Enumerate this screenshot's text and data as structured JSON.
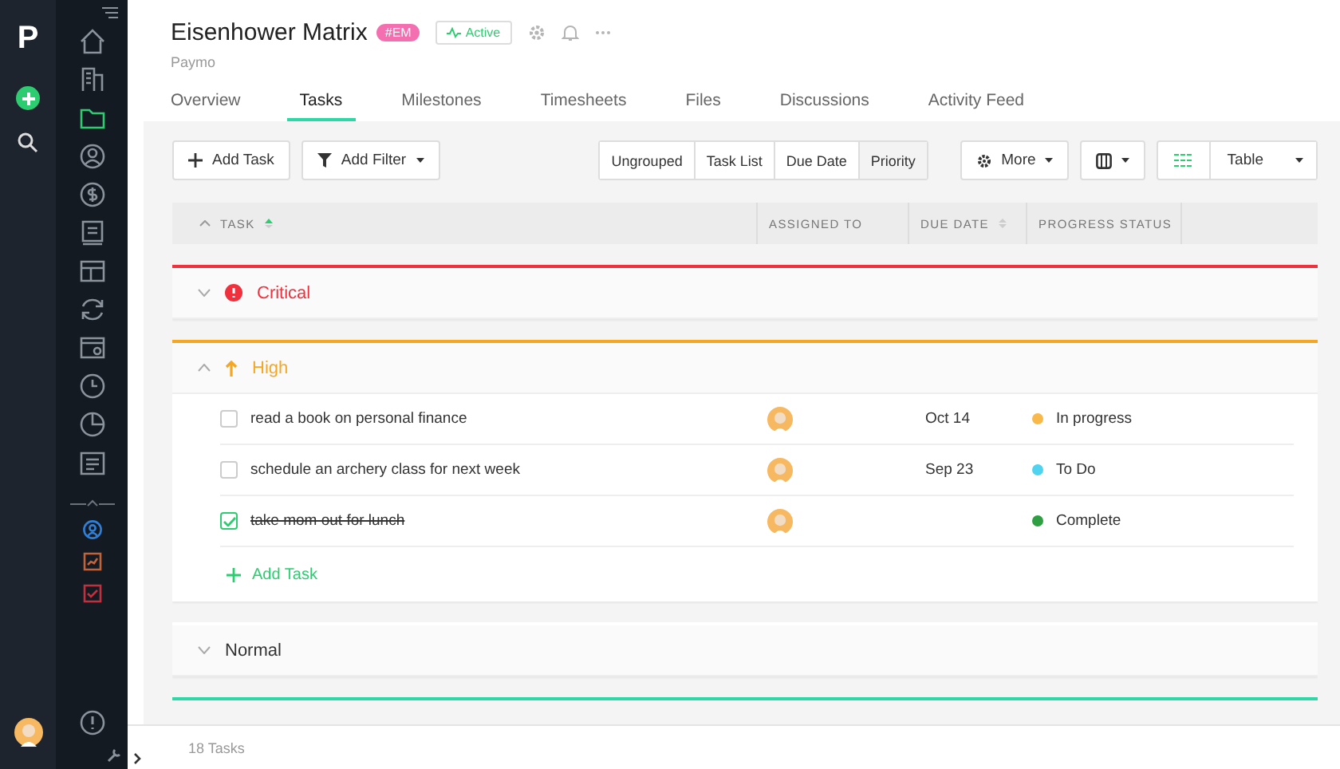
{
  "rail": {
    "logo": "P",
    "items": [
      {
        "selected": false
      },
      {
        "selected": false
      },
      {
        "selected": true
      },
      {
        "selected": false
      },
      {
        "selected": false
      },
      {
        "selected": false
      },
      {
        "selected": false
      },
      {
        "selected": false
      },
      {
        "selected": false
      },
      {
        "selected": false
      },
      {
        "selected": false
      },
      {
        "selected": false
      }
    ],
    "shortcuts": [
      {
        "color": "#2f7fd6"
      },
      {
        "color": "#c0623a"
      },
      {
        "color": "#c0303e"
      }
    ]
  },
  "header": {
    "title": "Eisenhower Matrix",
    "tag": "#EM",
    "status": "Active",
    "client": "Paymo"
  },
  "tabs": [
    {
      "label": "Overview",
      "selected": false
    },
    {
      "label": "Tasks",
      "selected": true
    },
    {
      "label": "Milestones",
      "selected": false
    },
    {
      "label": "Timesheets",
      "selected": false
    },
    {
      "label": "Files",
      "selected": false
    },
    {
      "label": "Discussions",
      "selected": false
    },
    {
      "label": "Activity Feed",
      "selected": false
    }
  ],
  "toolbar": {
    "add_task": "Add Task",
    "add_filter": "Add Filter",
    "grouping": [
      {
        "label": "Ungrouped",
        "selected": false
      },
      {
        "label": "Task List",
        "selected": false
      },
      {
        "label": "Due Date",
        "selected": false
      },
      {
        "label": "Priority",
        "selected": true
      }
    ],
    "more": "More",
    "view": "Table"
  },
  "table": {
    "columns": [
      "TASK",
      "ASSIGNED TO",
      "DUE DATE",
      "PROGRESS STATUS"
    ],
    "groups": [
      {
        "kind": "critical",
        "name": "Critical",
        "color": "#f0303c",
        "expanded": false
      },
      {
        "kind": "high",
        "name": "High",
        "color": "#f5a623",
        "expanded": true,
        "add_label": "Add Task",
        "tasks": [
          {
            "name": "read a book on personal finance",
            "checked": false,
            "due": "Oct 14",
            "status": "In progress",
            "color": "#f8b94a"
          },
          {
            "name": "schedule an archery class for next week",
            "checked": false,
            "due": "Sep 23",
            "status": "To Do",
            "color": "#4fd3ef"
          },
          {
            "name": "take mom out for lunch",
            "checked": true,
            "status": "Complete",
            "color": "#2ea043"
          }
        ]
      },
      {
        "kind": "normal",
        "name": "Normal",
        "expanded": false
      },
      {
        "color": "#2fd6a6"
      }
    ]
  },
  "footer": {
    "count": "18 Tasks"
  }
}
